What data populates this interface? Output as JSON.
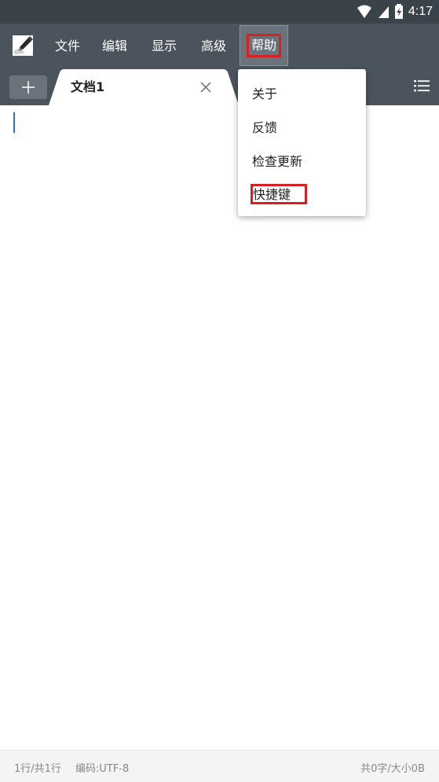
{
  "status_bar": {
    "time": "4:17",
    "icons": [
      "wifi-icon",
      "signal-icon",
      "battery-charging-icon"
    ]
  },
  "menu": {
    "items": [
      {
        "label": "文件"
      },
      {
        "label": "编辑"
      },
      {
        "label": "显示"
      },
      {
        "label": "高级"
      },
      {
        "label": "帮助"
      }
    ],
    "active": "帮助"
  },
  "tabs": {
    "add_icon": "plus-icon",
    "items": [
      {
        "title": "文档1",
        "close_icon": "close-icon"
      }
    ],
    "list_icon": "list-icon"
  },
  "dropdown": {
    "items": [
      {
        "label": "关于"
      },
      {
        "label": "反馈"
      },
      {
        "label": "检查更新"
      },
      {
        "label": "快捷键"
      }
    ]
  },
  "footer": {
    "line_info": "1行/共1行",
    "encoding": "编码:UTF-8",
    "size_info": "共0字/大小0B"
  },
  "colors": {
    "status_bar_bg": "#3a424a",
    "app_bar_bg": "#4b545d",
    "highlight_red": "#d7201f",
    "caret_blue": "#2a6fd1"
  }
}
